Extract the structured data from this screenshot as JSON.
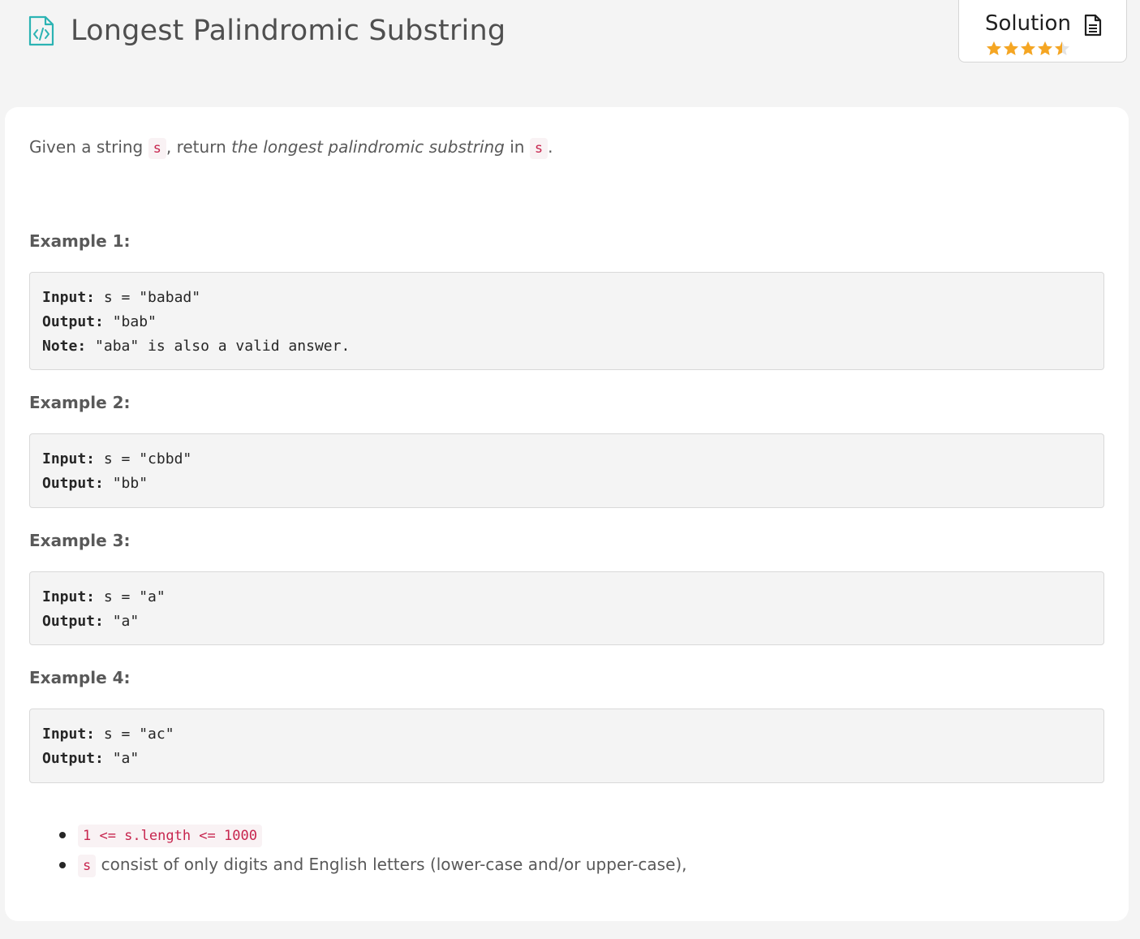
{
  "header": {
    "title": "Longest Palindromic Substring",
    "title_icon": "doc-code-icon",
    "solution_label": "Solution",
    "solution_icon": "doc-lines-icon",
    "rating": 4.5,
    "rating_max": 5,
    "star_color": "#f5a623",
    "accent_color": "#2bb3b3"
  },
  "description": {
    "part1": "Given a string ",
    "code1": "s",
    "part2": ", return ",
    "emph": "the longest palindromic substring",
    "part3": " in ",
    "code2": "s",
    "part4": "."
  },
  "examples": [
    {
      "title": "Example 1:",
      "input_label": "Input:",
      "input_value": " s = \"babad\"",
      "output_label": "Output:",
      "output_value": " \"bab\"",
      "note_label": "Note:",
      "note_value": " \"aba\" is also a valid answer."
    },
    {
      "title": "Example 2:",
      "input_label": "Input:",
      "input_value": " s = \"cbbd\"",
      "output_label": "Output:",
      "output_value": " \"bb\""
    },
    {
      "title": "Example 3:",
      "input_label": "Input:",
      "input_value": " s = \"a\"",
      "output_label": "Output:",
      "output_value": " \"a\""
    },
    {
      "title": "Example 4:",
      "input_label": "Input:",
      "input_value": " s = \"ac\"",
      "output_label": "Output:",
      "output_value": " \"a\""
    }
  ],
  "constraints": [
    {
      "code": "1 <= s.length <= 1000",
      "text": ""
    },
    {
      "code": "s",
      "text": " consist of only digits and English letters (lower-case and/or upper-case),"
    }
  ]
}
